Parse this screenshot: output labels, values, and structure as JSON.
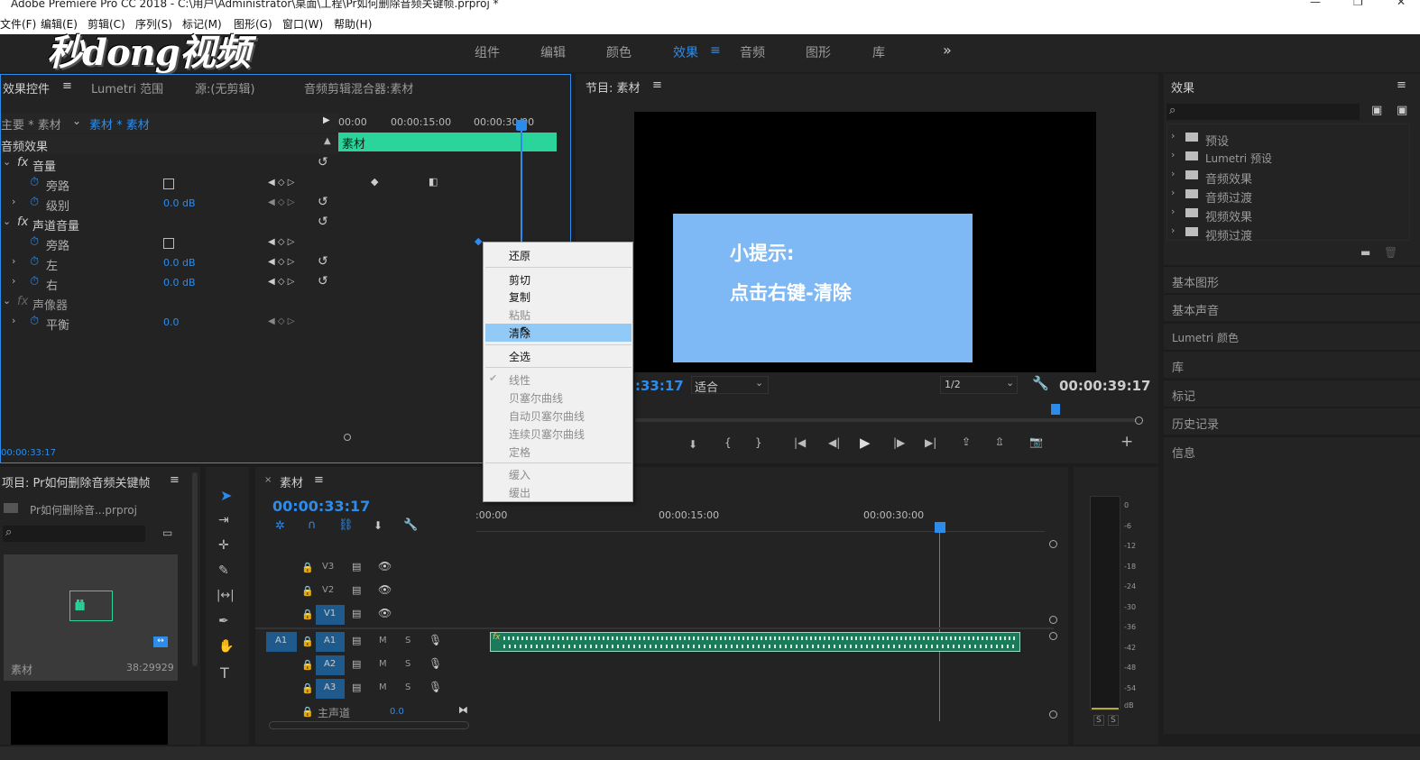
{
  "window": {
    "title": "Adobe Premiere Pro CC 2018 - C:\\用户\\Administrator\\桌面\\工程\\Pr如何删除音频关键帧.prproj *"
  },
  "menubar": [
    "文件(F)",
    "编辑(E)",
    "剪辑(C)",
    "序列(S)",
    "标记(M)",
    "图形(G)",
    "窗口(W)",
    "帮助(H)"
  ],
  "watermark": "秒dong视频",
  "workspaces": {
    "items": [
      "组件",
      "编辑",
      "颜色",
      "效果",
      "音频",
      "图形",
      "库"
    ],
    "active": "效果",
    "more": "»"
  },
  "effect_controls": {
    "tabs": [
      "效果控件",
      "Lumetri 范围",
      "源:(无剪辑)",
      "音频剪辑混合器:素材"
    ],
    "source": "主要 * 素材",
    "clip": "素材 * 素材",
    "ruler": [
      "00:00",
      "00:00:15:00",
      "00:00:30:00"
    ],
    "clip_bar": "素材",
    "section": "音频效果",
    "rows": [
      {
        "label": "音量",
        "kind": "fx"
      },
      {
        "label": "旁路",
        "kind": "checkbox"
      },
      {
        "label": "级别",
        "kind": "value",
        "value": "0.0 dB"
      },
      {
        "label": "声道音量",
        "kind": "fx"
      },
      {
        "label": "旁路",
        "kind": "checkbox"
      },
      {
        "label": "左",
        "kind": "value",
        "value": "0.0 dB"
      },
      {
        "label": "右",
        "kind": "value",
        "value": "0.0 dB"
      },
      {
        "label": "声像器",
        "kind": "fx"
      },
      {
        "label": "平衡",
        "kind": "value",
        "value": "0.0"
      }
    ],
    "timecode": "00:00:33:17"
  },
  "context_menu": {
    "items": [
      {
        "label": "还原",
        "enabled": true
      },
      {
        "label": "剪切",
        "enabled": true
      },
      {
        "label": "复制",
        "enabled": true
      },
      {
        "label": "粘贴",
        "enabled": false
      },
      {
        "label": "清除",
        "enabled": true,
        "highlighted": true
      },
      {
        "label": "全选",
        "enabled": true
      },
      {
        "label": "线性",
        "enabled": false,
        "checked": true
      },
      {
        "label": "贝塞尔曲线",
        "enabled": false
      },
      {
        "label": "自动贝塞尔曲线",
        "enabled": false
      },
      {
        "label": "连续贝塞尔曲线",
        "enabled": false
      },
      {
        "label": "定格",
        "enabled": false
      },
      {
        "label": "缓入",
        "enabled": false
      },
      {
        "label": "缓出",
        "enabled": false
      }
    ]
  },
  "program_monitor": {
    "title": "节目: 素材",
    "tip_line1": "小提示:",
    "tip_line2": "点击右键-清除",
    "timecode_left": ":33:17",
    "fit": "适合",
    "quality": "1/2",
    "duration": "00:00:39:17"
  },
  "effects_panel": {
    "title": "效果",
    "search_placeholder": "",
    "tree": [
      "预设",
      "Lumetri 预设",
      "音频效果",
      "音频过渡",
      "视频效果",
      "视频过渡"
    ],
    "collapsed": [
      "基本图形",
      "基本声音",
      "Lumetri 颜色",
      "库",
      "标记",
      "历史记录",
      "信息"
    ]
  },
  "project": {
    "title": "项目: Pr如何删除音频关键帧",
    "file": "Pr如何删除音...prproj",
    "clip_name": "素材",
    "clip_duration": "38:29929"
  },
  "timeline": {
    "tab": "素材",
    "timecode": "00:00:33:17",
    "ruler": [
      ":00:00",
      "00:00:15:00",
      "00:00:30:00"
    ],
    "tracks": [
      {
        "id": "V3",
        "type": "video"
      },
      {
        "id": "V2",
        "type": "video"
      },
      {
        "id": "V1",
        "type": "video"
      },
      {
        "id": "A1",
        "type": "audio",
        "source": "A1"
      },
      {
        "id": "A2",
        "type": "audio"
      },
      {
        "id": "A3",
        "type": "audio"
      }
    ],
    "master": {
      "label": "主声道",
      "value": "0.0"
    },
    "m_label": "M",
    "s_label": "S"
  },
  "audio_meter": {
    "scale": [
      "0",
      "-6",
      "-12",
      "-18",
      "-24",
      "-30",
      "-36",
      "-42",
      "-48",
      "-54",
      "dB"
    ],
    "solo": [
      "S",
      "S"
    ]
  },
  "colors": {
    "accent": "#2d8ceb",
    "clip_green": "#2bd49a",
    "audio_clip": "#1b7a5a",
    "tip_bg": "#7fb9f5",
    "menu_highlight": "#91c9f7"
  }
}
